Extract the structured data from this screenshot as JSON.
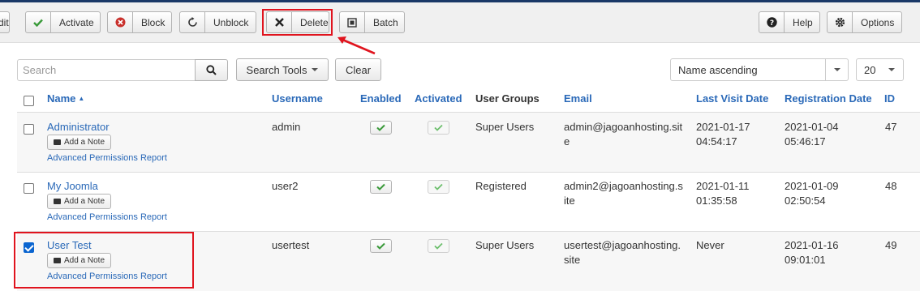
{
  "toolbar": {
    "buttons": [
      {
        "label": "dit",
        "icon": "edit-icon"
      },
      {
        "label": "Activate",
        "icon": "check-icon"
      },
      {
        "label": "Block",
        "icon": "block-icon"
      },
      {
        "label": "Unblock",
        "icon": "refresh-icon"
      },
      {
        "label": "Delete",
        "icon": "close-icon"
      },
      {
        "label": "Batch",
        "icon": "square-icon"
      },
      {
        "label": "Help",
        "icon": "question-icon"
      },
      {
        "label": "Options",
        "icon": "gear-icon"
      }
    ]
  },
  "filters": {
    "search_placeholder": "Search",
    "search_tools_label": "Search Tools",
    "clear_label": "Clear",
    "sort_value": "Name ascending",
    "limit_value": "20"
  },
  "table": {
    "columns": [
      "Name",
      "Username",
      "Enabled",
      "Activated",
      "User Groups",
      "Email",
      "Last Visit Date",
      "Registration Date",
      "ID"
    ],
    "add_note_label": "Add a Note",
    "permissions_label": "Advanced Permissions Report",
    "rows": [
      {
        "name": "Administrator",
        "username": "admin",
        "groups": "Super Users",
        "email_1": "admin@jagoanhosting.sit",
        "email_2": "e",
        "last_visit_1": "2021-01-17",
        "last_visit_2": "04:54:17",
        "reg_1": "2021-01-04",
        "reg_2": "05:46:17",
        "id": "47",
        "checked": false
      },
      {
        "name": "My Joomla",
        "username": "user2",
        "groups": "Registered",
        "email_1": "admin2@jagoanhosting.s",
        "email_2": "ite",
        "last_visit_1": "2021-01-11",
        "last_visit_2": "01:35:58",
        "reg_1": "2021-01-09",
        "reg_2": "02:50:54",
        "id": "48",
        "checked": false
      },
      {
        "name": "User Test",
        "username": "usertest",
        "groups": "Super Users",
        "email_1": "usertest@jagoanhosting.",
        "email_2": "site",
        "last_visit_1": "Never",
        "last_visit_2": "",
        "reg_1": "2021-01-16",
        "reg_2": "09:01:01",
        "id": "49",
        "checked": true
      }
    ]
  },
  "colors": {
    "link": "#2a69b8",
    "highlight": "#e0141e",
    "check_green": "#3a9a3a",
    "checkbox_checked": "#0b65d0"
  }
}
